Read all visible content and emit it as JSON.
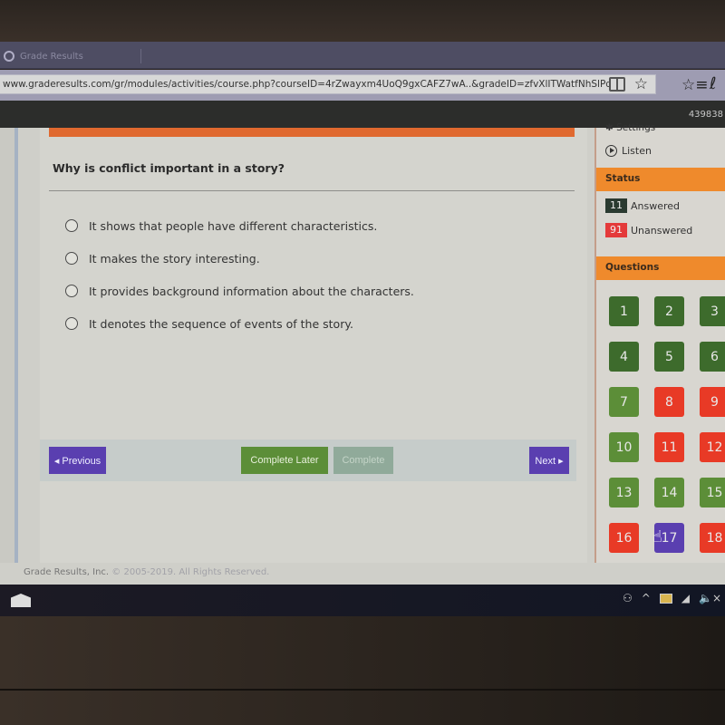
{
  "browser": {
    "tab_title": "Grade Results",
    "url": "www.graderesults.com/gr/modules/activities/course.php?courseID=4rZwayxm4UoQ9gxCAFZ7wA..&gradeID=zfvXlITWatfNhSlPdHBqsA..#questic",
    "icons": [
      "reading-view-icon",
      "favorite-star-icon",
      "favorites-list-icon",
      "notes-pen-icon"
    ]
  },
  "header": {
    "user_id": "439838"
  },
  "question": {
    "text": "Why is conflict important in a story?",
    "options": [
      "It shows that people have different characteristics.",
      "It makes the story interesting.",
      "It provides background information about the characters.",
      "It denotes the sequence of events of the story."
    ]
  },
  "navigation": {
    "previous": "◂ Previous",
    "complete_later": "Complete Later",
    "complete": "Complete",
    "next": "Next ▸"
  },
  "sidebar": {
    "settings": "Settings",
    "listen": "Listen",
    "status_heading": "Status",
    "answered_count": "11",
    "answered_label": "Answered",
    "unanswered_count": "91",
    "unanswered_label": "Unanswered",
    "questions_heading": "Questions",
    "colors": {
      "answered_dark": "#3d6b2c",
      "answered_light": "#5c8e38",
      "unanswered": "#e83a26",
      "current": "#5a3fb0",
      "answered_badge": "#2a3a30",
      "unanswered_badge": "#e43a3a",
      "section_head": "#ef8a2c"
    },
    "questions": [
      {
        "n": "1",
        "state": "answered_dark"
      },
      {
        "n": "2",
        "state": "answered_dark"
      },
      {
        "n": "3",
        "state": "answered_dark"
      },
      {
        "n": "4",
        "state": "answered_dark"
      },
      {
        "n": "5",
        "state": "answered_dark"
      },
      {
        "n": "6",
        "state": "answered_dark"
      },
      {
        "n": "7",
        "state": "answered_light"
      },
      {
        "n": "8",
        "state": "unanswered"
      },
      {
        "n": "9",
        "state": "unanswered"
      },
      {
        "n": "10",
        "state": "answered_light"
      },
      {
        "n": "11",
        "state": "unanswered"
      },
      {
        "n": "12",
        "state": "unanswered"
      },
      {
        "n": "13",
        "state": "answered_light"
      },
      {
        "n": "14",
        "state": "answered_light"
      },
      {
        "n": "15",
        "state": "answered_light"
      },
      {
        "n": "16",
        "state": "unanswered"
      },
      {
        "n": "17",
        "state": "current"
      },
      {
        "n": "18",
        "state": "unanswered"
      }
    ]
  },
  "footer": {
    "company": "Grade Results, Inc.",
    "copyright": "© 2005-2019. All Rights Reserved."
  },
  "taskbar": {
    "tray_icons": [
      "people-icon",
      "chevron-up-icon",
      "network-icon",
      "wifi-icon",
      "volume-muted-icon"
    ]
  }
}
